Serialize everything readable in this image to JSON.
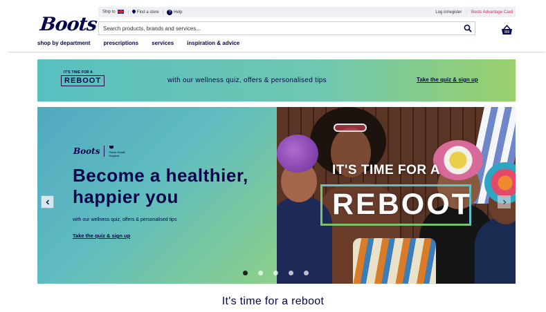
{
  "topbar": {
    "ship_to": "Ship to",
    "find_store": "Find a store",
    "help": "Help",
    "login": "Log in/register",
    "advantage": "Boots Advantage Card"
  },
  "brand": {
    "logo": "Boots"
  },
  "search": {
    "placeholder": "Search products, brands and services..."
  },
  "nav": {
    "items": [
      "shop by department",
      "prescriptions",
      "services",
      "inspiration & advice"
    ]
  },
  "promo": {
    "kicker": "IT'S TIME FOR A",
    "badge": "REBOOT",
    "message": "with our wellness quiz, offers & personalised tips",
    "cta": "Take the quiz & sign up"
  },
  "hero": {
    "cobrand_logo": "Boots",
    "partner": [
      "Public Health",
      "England"
    ],
    "title": "Become a healthier, happier you",
    "subtitle": "with our wellness quiz, offers & personalised tips",
    "cta": "Take the quiz & sign up",
    "overlay_kicker": "IT'S TIME FOR A",
    "overlay_word": "REBOOT",
    "slides_total": 5,
    "slide_active": 1
  },
  "section": {
    "title": "It's time for a reboot"
  },
  "colors": {
    "navy": "#05054b",
    "teal": "#5fbcc0",
    "green": "#8dd08a",
    "advantage_pink": "#c0335c"
  },
  "icons": [
    "uk-flag-icon",
    "location-pin-icon",
    "help-icon",
    "search-icon",
    "basket-icon",
    "chevron-left-icon",
    "chevron-right-icon"
  ]
}
